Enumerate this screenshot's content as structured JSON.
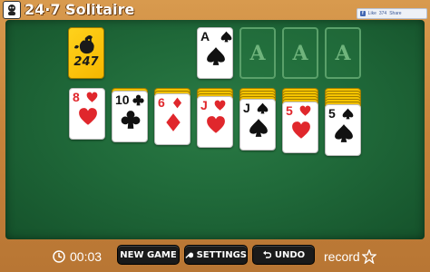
{
  "header": {
    "logo_text": "24·7 Solitaire",
    "social": {
      "like_label": "Like",
      "like_count": "374",
      "share_label": "Share"
    }
  },
  "stock": {
    "logo_text": "247",
    "icon": "rooster-icon"
  },
  "waste": {
    "rank": "A",
    "suit": "spades",
    "color": "#111111"
  },
  "foundations": [
    {
      "placeholder": "A"
    },
    {
      "placeholder": "A"
    },
    {
      "placeholder": "A"
    }
  ],
  "tableau": [
    {
      "hidden_count": 0,
      "rank": "8",
      "suit": "hearts",
      "color": "#e0272c"
    },
    {
      "hidden_count": 1,
      "rank": "10",
      "suit": "clubs",
      "color": "#111111"
    },
    {
      "hidden_count": 2,
      "rank": "6",
      "suit": "diamonds",
      "color": "#e0272c"
    },
    {
      "hidden_count": 3,
      "rank": "J",
      "suit": "hearts",
      "color": "#e0272c"
    },
    {
      "hidden_count": 4,
      "rank": "J",
      "suit": "spades",
      "color": "#111111"
    },
    {
      "hidden_count": 5,
      "rank": "5",
      "suit": "hearts",
      "color": "#e0272c"
    },
    {
      "hidden_count": 6,
      "rank": "5",
      "suit": "spades",
      "color": "#111111"
    }
  ],
  "toolbar": {
    "timer": "00:03",
    "new_game_label": "NEW GAME",
    "settings_label": "SETTINGS",
    "undo_label": "UNDO",
    "record_label": "record"
  },
  "colors": {
    "felt": "#206a3a",
    "card_back": "#f6c400",
    "wood": "#c5823a"
  }
}
